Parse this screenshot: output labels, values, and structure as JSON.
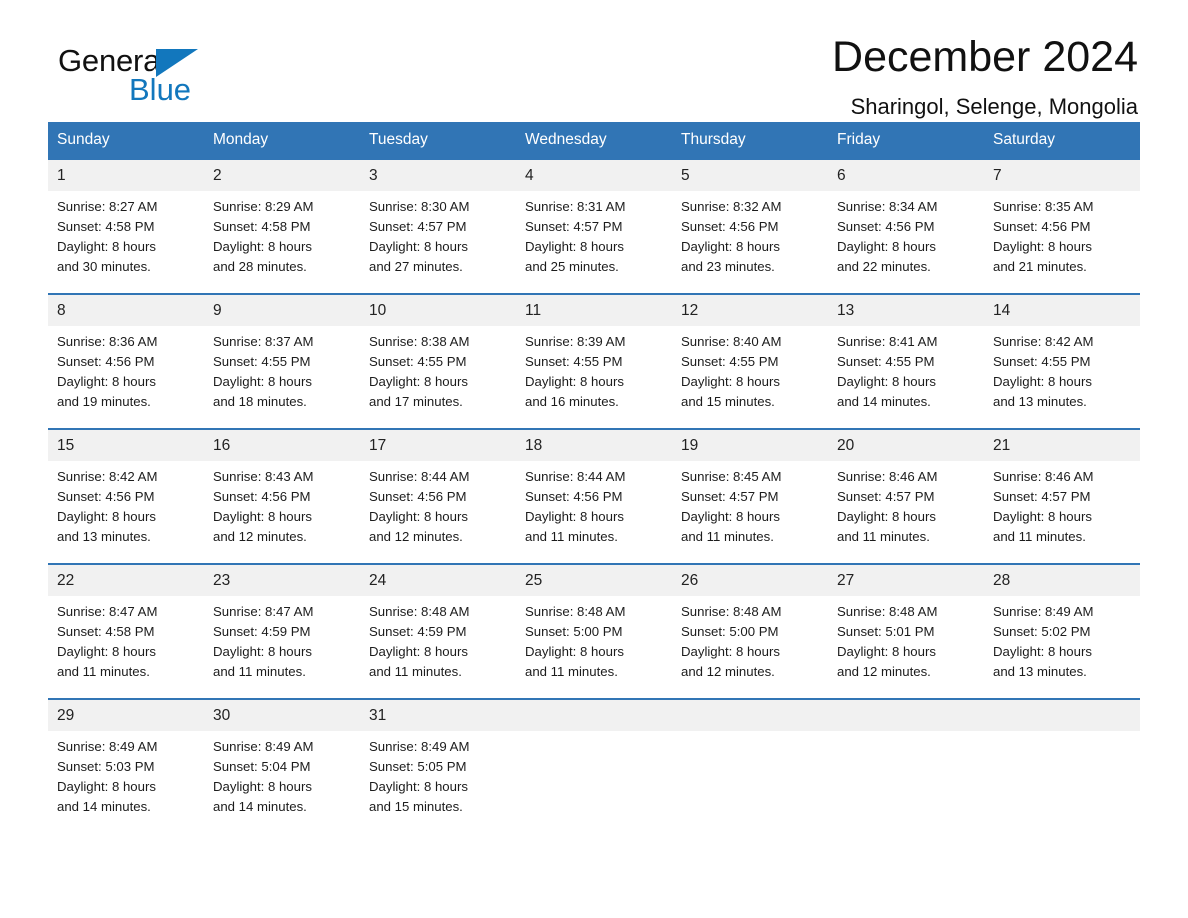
{
  "brand": {
    "name_part1": "General",
    "name_part2": "Blue",
    "triangle_icon": "blue-triangle-icon",
    "accent_color": "#1277bd"
  },
  "header": {
    "title": "December 2024",
    "subtitle": "Sharingol, Selenge, Mongolia"
  },
  "theme": {
    "header_blue": "#3175b5",
    "daynum_band": "#f1f1f1",
    "text": "#1c1c1c"
  },
  "calendar": {
    "weekday_headers": [
      "Sunday",
      "Monday",
      "Tuesday",
      "Wednesday",
      "Thursday",
      "Friday",
      "Saturday"
    ],
    "weeks": [
      [
        {
          "day": "1",
          "sunrise": "Sunrise: 8:27 AM",
          "sunset": "Sunset: 4:58 PM",
          "daylight_line1": "Daylight: 8 hours",
          "daylight_line2": "and 30 minutes."
        },
        {
          "day": "2",
          "sunrise": "Sunrise: 8:29 AM",
          "sunset": "Sunset: 4:58 PM",
          "daylight_line1": "Daylight: 8 hours",
          "daylight_line2": "and 28 minutes."
        },
        {
          "day": "3",
          "sunrise": "Sunrise: 8:30 AM",
          "sunset": "Sunset: 4:57 PM",
          "daylight_line1": "Daylight: 8 hours",
          "daylight_line2": "and 27 minutes."
        },
        {
          "day": "4",
          "sunrise": "Sunrise: 8:31 AM",
          "sunset": "Sunset: 4:57 PM",
          "daylight_line1": "Daylight: 8 hours",
          "daylight_line2": "and 25 minutes."
        },
        {
          "day": "5",
          "sunrise": "Sunrise: 8:32 AM",
          "sunset": "Sunset: 4:56 PM",
          "daylight_line1": "Daylight: 8 hours",
          "daylight_line2": "and 23 minutes."
        },
        {
          "day": "6",
          "sunrise": "Sunrise: 8:34 AM",
          "sunset": "Sunset: 4:56 PM",
          "daylight_line1": "Daylight: 8 hours",
          "daylight_line2": "and 22 minutes."
        },
        {
          "day": "7",
          "sunrise": "Sunrise: 8:35 AM",
          "sunset": "Sunset: 4:56 PM",
          "daylight_line1": "Daylight: 8 hours",
          "daylight_line2": "and 21 minutes."
        }
      ],
      [
        {
          "day": "8",
          "sunrise": "Sunrise: 8:36 AM",
          "sunset": "Sunset: 4:56 PM",
          "daylight_line1": "Daylight: 8 hours",
          "daylight_line2": "and 19 minutes."
        },
        {
          "day": "9",
          "sunrise": "Sunrise: 8:37 AM",
          "sunset": "Sunset: 4:55 PM",
          "daylight_line1": "Daylight: 8 hours",
          "daylight_line2": "and 18 minutes."
        },
        {
          "day": "10",
          "sunrise": "Sunrise: 8:38 AM",
          "sunset": "Sunset: 4:55 PM",
          "daylight_line1": "Daylight: 8 hours",
          "daylight_line2": "and 17 minutes."
        },
        {
          "day": "11",
          "sunrise": "Sunrise: 8:39 AM",
          "sunset": "Sunset: 4:55 PM",
          "daylight_line1": "Daylight: 8 hours",
          "daylight_line2": "and 16 minutes."
        },
        {
          "day": "12",
          "sunrise": "Sunrise: 8:40 AM",
          "sunset": "Sunset: 4:55 PM",
          "daylight_line1": "Daylight: 8 hours",
          "daylight_line2": "and 15 minutes."
        },
        {
          "day": "13",
          "sunrise": "Sunrise: 8:41 AM",
          "sunset": "Sunset: 4:55 PM",
          "daylight_line1": "Daylight: 8 hours",
          "daylight_line2": "and 14 minutes."
        },
        {
          "day": "14",
          "sunrise": "Sunrise: 8:42 AM",
          "sunset": "Sunset: 4:55 PM",
          "daylight_line1": "Daylight: 8 hours",
          "daylight_line2": "and 13 minutes."
        }
      ],
      [
        {
          "day": "15",
          "sunrise": "Sunrise: 8:42 AM",
          "sunset": "Sunset: 4:56 PM",
          "daylight_line1": "Daylight: 8 hours",
          "daylight_line2": "and 13 minutes."
        },
        {
          "day": "16",
          "sunrise": "Sunrise: 8:43 AM",
          "sunset": "Sunset: 4:56 PM",
          "daylight_line1": "Daylight: 8 hours",
          "daylight_line2": "and 12 minutes."
        },
        {
          "day": "17",
          "sunrise": "Sunrise: 8:44 AM",
          "sunset": "Sunset: 4:56 PM",
          "daylight_line1": "Daylight: 8 hours",
          "daylight_line2": "and 12 minutes."
        },
        {
          "day": "18",
          "sunrise": "Sunrise: 8:44 AM",
          "sunset": "Sunset: 4:56 PM",
          "daylight_line1": "Daylight: 8 hours",
          "daylight_line2": "and 11 minutes."
        },
        {
          "day": "19",
          "sunrise": "Sunrise: 8:45 AM",
          "sunset": "Sunset: 4:57 PM",
          "daylight_line1": "Daylight: 8 hours",
          "daylight_line2": "and 11 minutes."
        },
        {
          "day": "20",
          "sunrise": "Sunrise: 8:46 AM",
          "sunset": "Sunset: 4:57 PM",
          "daylight_line1": "Daylight: 8 hours",
          "daylight_line2": "and 11 minutes."
        },
        {
          "day": "21",
          "sunrise": "Sunrise: 8:46 AM",
          "sunset": "Sunset: 4:57 PM",
          "daylight_line1": "Daylight: 8 hours",
          "daylight_line2": "and 11 minutes."
        }
      ],
      [
        {
          "day": "22",
          "sunrise": "Sunrise: 8:47 AM",
          "sunset": "Sunset: 4:58 PM",
          "daylight_line1": "Daylight: 8 hours",
          "daylight_line2": "and 11 minutes."
        },
        {
          "day": "23",
          "sunrise": "Sunrise: 8:47 AM",
          "sunset": "Sunset: 4:59 PM",
          "daylight_line1": "Daylight: 8 hours",
          "daylight_line2": "and 11 minutes."
        },
        {
          "day": "24",
          "sunrise": "Sunrise: 8:48 AM",
          "sunset": "Sunset: 4:59 PM",
          "daylight_line1": "Daylight: 8 hours",
          "daylight_line2": "and 11 minutes."
        },
        {
          "day": "25",
          "sunrise": "Sunrise: 8:48 AM",
          "sunset": "Sunset: 5:00 PM",
          "daylight_line1": "Daylight: 8 hours",
          "daylight_line2": "and 11 minutes."
        },
        {
          "day": "26",
          "sunrise": "Sunrise: 8:48 AM",
          "sunset": "Sunset: 5:00 PM",
          "daylight_line1": "Daylight: 8 hours",
          "daylight_line2": "and 12 minutes."
        },
        {
          "day": "27",
          "sunrise": "Sunrise: 8:48 AM",
          "sunset": "Sunset: 5:01 PM",
          "daylight_line1": "Daylight: 8 hours",
          "daylight_line2": "and 12 minutes."
        },
        {
          "day": "28",
          "sunrise": "Sunrise: 8:49 AM",
          "sunset": "Sunset: 5:02 PM",
          "daylight_line1": "Daylight: 8 hours",
          "daylight_line2": "and 13 minutes."
        }
      ],
      [
        {
          "day": "29",
          "sunrise": "Sunrise: 8:49 AM",
          "sunset": "Sunset: 5:03 PM",
          "daylight_line1": "Daylight: 8 hours",
          "daylight_line2": "and 14 minutes."
        },
        {
          "day": "30",
          "sunrise": "Sunrise: 8:49 AM",
          "sunset": "Sunset: 5:04 PM",
          "daylight_line1": "Daylight: 8 hours",
          "daylight_line2": "and 14 minutes."
        },
        {
          "day": "31",
          "sunrise": "Sunrise: 8:49 AM",
          "sunset": "Sunset: 5:05 PM",
          "daylight_line1": "Daylight: 8 hours",
          "daylight_line2": "and 15 minutes."
        },
        {
          "day": "",
          "sunrise": "",
          "sunset": "",
          "daylight_line1": "",
          "daylight_line2": ""
        },
        {
          "day": "",
          "sunrise": "",
          "sunset": "",
          "daylight_line1": "",
          "daylight_line2": ""
        },
        {
          "day": "",
          "sunrise": "",
          "sunset": "",
          "daylight_line1": "",
          "daylight_line2": ""
        },
        {
          "day": "",
          "sunrise": "",
          "sunset": "",
          "daylight_line1": "",
          "daylight_line2": ""
        }
      ]
    ]
  }
}
